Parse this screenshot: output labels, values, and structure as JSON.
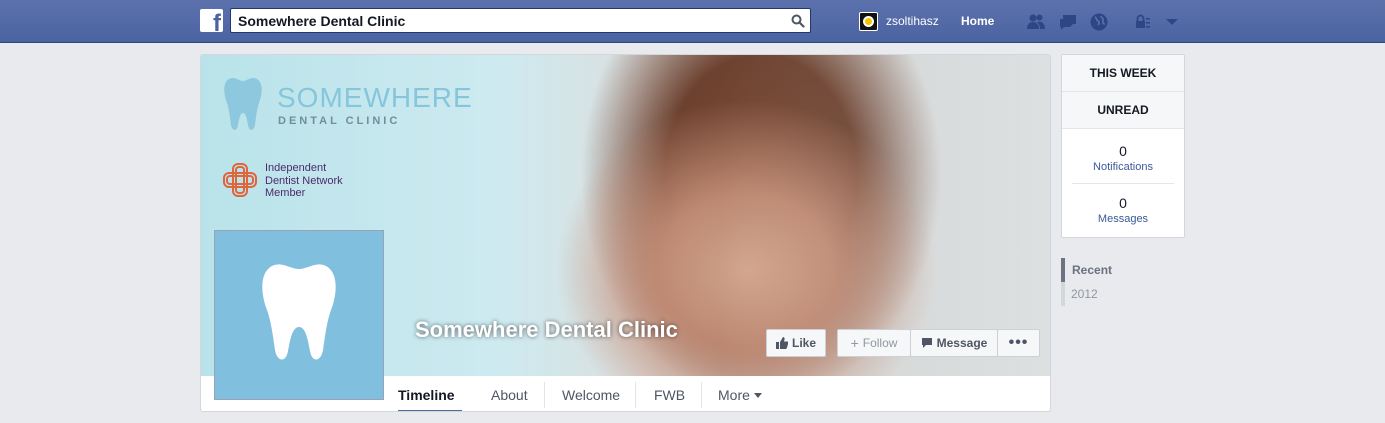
{
  "topbar": {
    "logo": "f",
    "search_value": "Somewhere Dental Clinic",
    "user_name": "zsoltihasz",
    "home_label": "Home",
    "icons": [
      "friends-icon",
      "messages-icon",
      "notifications-globe-icon",
      "privacy-lock-icon",
      "account-dropdown-icon"
    ]
  },
  "cover": {
    "brand_title": "SOMEWHERE",
    "brand_subtitle": "DENTAL CLINIC",
    "network_line1": "Independent",
    "network_line2": "Dentist Network",
    "network_line3": "Member",
    "page_name": "Somewhere Dental Clinic"
  },
  "actions": {
    "like": "Like",
    "follow": "Follow",
    "message": "Message",
    "more": "•••"
  },
  "tabs": [
    {
      "label": "Timeline"
    },
    {
      "label": "About"
    },
    {
      "label": "Welcome"
    },
    {
      "label": "FWB"
    },
    {
      "label": "More"
    }
  ],
  "sidebar": {
    "this_week": "THIS WEEK",
    "unread": "UNREAD",
    "notifications_count": "0",
    "notifications_label": "Notifications",
    "messages_count": "0",
    "messages_label": "Messages"
  },
  "years": {
    "recent": "Recent",
    "y2012": "2012"
  },
  "colors": {
    "topbar": "#4c63a2",
    "brand_blue": "#86c6dc",
    "profile_bg": "#81bfdf",
    "link": "#3b5998"
  }
}
